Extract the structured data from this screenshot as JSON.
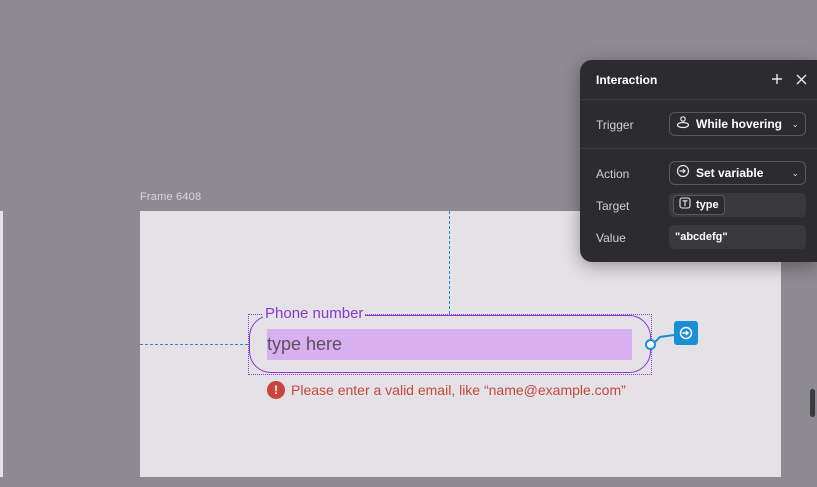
{
  "canvas": {
    "frame_label": "Frame 6408"
  },
  "component": {
    "field_label": "Phone number",
    "input_placeholder": "type here",
    "error_icon": "!",
    "error_text": "Please enter a valid email, like “name@example.com”"
  },
  "panel": {
    "title": "Interaction",
    "add_icon": "plus-icon",
    "close_icon": "close-icon",
    "trigger": {
      "label": "Trigger",
      "value": "While hovering",
      "icon": "hover-icon"
    },
    "action": {
      "label": "Action",
      "value": "Set variable",
      "icon": "set-variable-icon"
    },
    "target": {
      "label": "Target",
      "value": "type",
      "icon": "text-variable-icon"
    },
    "value": {
      "label": "Value",
      "value": "\"abcdefg\""
    }
  },
  "colors": {
    "canvas_bg": "#8e8a91",
    "frame_bg": "#e4e2e6",
    "accent_purple": "#8a35d4",
    "input_fill": "#d8b0ef",
    "error_red": "#c8463e",
    "connector_blue": "#1a8fd6",
    "panel_bg": "#2c2c2e"
  }
}
